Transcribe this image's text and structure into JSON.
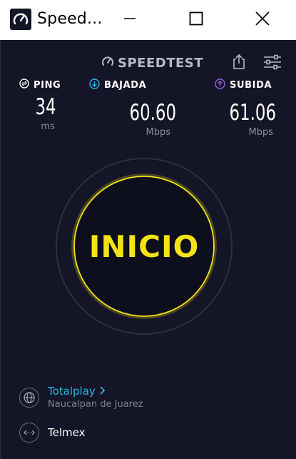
{
  "window": {
    "title": "Speed...",
    "minimize_icon": "minimize-icon",
    "maximize_icon": "maximize-icon",
    "close_icon": "close-icon"
  },
  "header": {
    "brand": "SPEEDTEST",
    "share_icon": "share-icon",
    "settings_icon": "sliders-icon"
  },
  "metrics": {
    "ping": {
      "label": "PING",
      "value": "34",
      "unit": "ms",
      "color": "#ffffff"
    },
    "download": {
      "label": "BAJADA",
      "value": "60.60",
      "unit": "Mbps",
      "color": "#2bb3e8"
    },
    "upload": {
      "label": "SUBIDA",
      "value": "61.06",
      "unit": "Mbps",
      "color": "#9b5de5"
    }
  },
  "gauge": {
    "start_label": "INICIO",
    "accent": "#f3e316"
  },
  "server": {
    "name": "Totalplay",
    "location": "Naucalpan de Juarez",
    "provider": "Telmex"
  }
}
